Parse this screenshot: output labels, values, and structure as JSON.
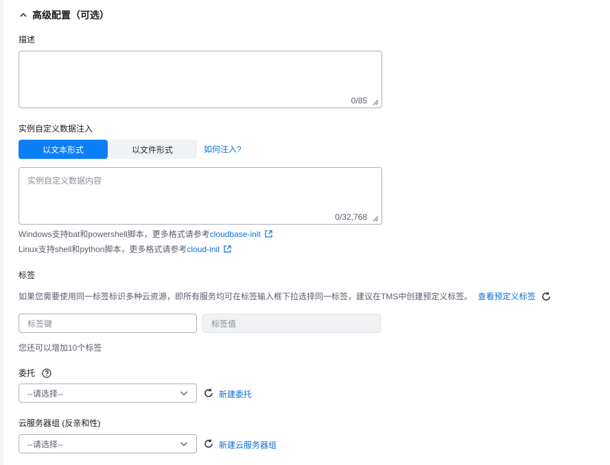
{
  "section": {
    "title": "高级配置（可选）"
  },
  "description": {
    "label": "描述",
    "value": "",
    "counter": "0/85"
  },
  "user_data": {
    "label": "实例自定义数据注入",
    "tabs": [
      {
        "label": "以文本形式",
        "active": true
      },
      {
        "label": "以文件形式",
        "active": false
      }
    ],
    "help_link": "如何注入?",
    "placeholder": "实例自定义数据内容",
    "counter": "0/32,768",
    "hint_windows": "Windows支持bat和powershell脚本，更多格式请参考",
    "hint_windows_link": "cloudbase-init",
    "hint_linux": "Linux支持shell和python脚本，更多格式请参考",
    "hint_linux_link": "cloud-init"
  },
  "tags": {
    "label": "标签",
    "hint": "如果您需要使用同一标签标识多种云资源，即所有服务均可在标签输入框下拉选择同一标签，建议在TMS中创建预定义标签。",
    "predefined_link": "查看预定义标签",
    "key_placeholder": "标签键",
    "value_placeholder": "标签值",
    "remaining": "您还可以增加10个标签"
  },
  "agency": {
    "label": "委托",
    "select_value": "--请选择--",
    "create_link": "新建委托"
  },
  "server_group": {
    "label": "云服务器组 (反亲和性)",
    "select_value": "--请选择--",
    "create_link": "新建云服务器组"
  },
  "colors": {
    "primary": "#0d7ff6",
    "link": "#0d6fd8",
    "border": "#adb0b8"
  },
  "icons": {
    "collapse": "chevron-up-icon",
    "resize": "resize-handle-icon",
    "external": "external-link-icon",
    "refresh": "refresh-icon",
    "help": "question-circle-icon",
    "dropdown": "chevron-down-icon"
  }
}
